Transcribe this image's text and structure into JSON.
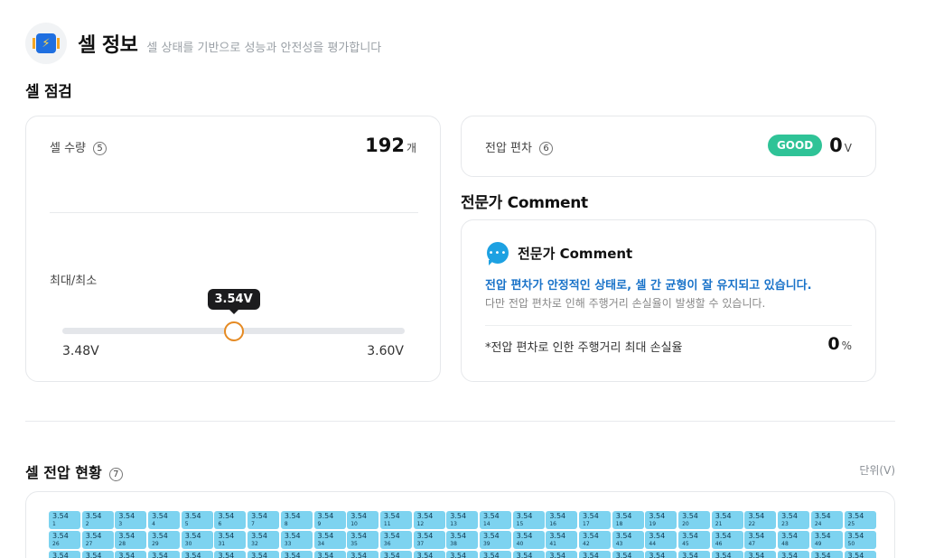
{
  "header": {
    "title": "셀 정보",
    "subtitle": "셀 상태를 기반으로 성능과 안전성을 평가합니다",
    "icon": "battery-chip-icon"
  },
  "inspection": {
    "section_title": "셀 점검",
    "cell_count": {
      "label": "셀 수량",
      "badge": "5",
      "value": "192",
      "unit": "개"
    },
    "minmax": {
      "label": "최대/최소",
      "current": "3.54V",
      "min": "3.48V",
      "max": "3.60V",
      "level_fraction": 0.5
    },
    "deviation": {
      "label": "전압 편차",
      "badge": "6",
      "status": "GOOD",
      "value": "0",
      "unit": "V",
      "status_color": "#2fc397"
    }
  },
  "expert": {
    "section_title": "전문가 Comment",
    "card_title": "전문가 Comment",
    "headline": "전압 편차가 안정적인 상태로, 셀 간 균형이 잘 유지되고 있습니다.",
    "detail": "다만 전압 편차로 인해 주행거리 손실율이 발생할 수 있습니다.",
    "loss_label": "*전압 편차로 인한 주행거리 최대 손실율",
    "loss_value": "0",
    "loss_unit": "%",
    "headline_color": "#1a73c9"
  },
  "voltage_status": {
    "section_title": "셀 전압 현황",
    "badge": "7",
    "unit_label": "단위(V)",
    "cells": [
      {
        "v": "3.54",
        "i": "1"
      },
      {
        "v": "3.54",
        "i": "2"
      },
      {
        "v": "3.54",
        "i": "3"
      },
      {
        "v": "3.54",
        "i": "4"
      },
      {
        "v": "3.54",
        "i": "5"
      },
      {
        "v": "3.54",
        "i": "6"
      },
      {
        "v": "3.54",
        "i": "7"
      },
      {
        "v": "3.54",
        "i": "8"
      },
      {
        "v": "3.54",
        "i": "9"
      },
      {
        "v": "3.54",
        "i": "10"
      },
      {
        "v": "3.54",
        "i": "11"
      },
      {
        "v": "3.54",
        "i": "12"
      },
      {
        "v": "3.54",
        "i": "13"
      },
      {
        "v": "3.54",
        "i": "14"
      },
      {
        "v": "3.54",
        "i": "15"
      },
      {
        "v": "3.54",
        "i": "16"
      },
      {
        "v": "3.54",
        "i": "17"
      },
      {
        "v": "3.54",
        "i": "18"
      },
      {
        "v": "3.54",
        "i": "19"
      },
      {
        "v": "3.54",
        "i": "20"
      },
      {
        "v": "3.54",
        "i": "21"
      },
      {
        "v": "3.54",
        "i": "22"
      },
      {
        "v": "3.54",
        "i": "23"
      },
      {
        "v": "3.54",
        "i": "24"
      },
      {
        "v": "3.54",
        "i": "25"
      },
      {
        "v": "3.54",
        "i": "26"
      },
      {
        "v": "3.54",
        "i": "27"
      },
      {
        "v": "3.54",
        "i": "28"
      },
      {
        "v": "3.54",
        "i": "29"
      },
      {
        "v": "3.54",
        "i": "30"
      },
      {
        "v": "3.54",
        "i": "31"
      },
      {
        "v": "3.54",
        "i": "32"
      },
      {
        "v": "3.54",
        "i": "33"
      },
      {
        "v": "3.54",
        "i": "34"
      },
      {
        "v": "3.54",
        "i": "35"
      },
      {
        "v": "3.54",
        "i": "36"
      },
      {
        "v": "3.54",
        "i": "37"
      },
      {
        "v": "3.54",
        "i": "38"
      },
      {
        "v": "3.54",
        "i": "39"
      },
      {
        "v": "3.54",
        "i": "40"
      },
      {
        "v": "3.54",
        "i": "41"
      },
      {
        "v": "3.54",
        "i": "42"
      },
      {
        "v": "3.54",
        "i": "43"
      },
      {
        "v": "3.54",
        "i": "44"
      },
      {
        "v": "3.54",
        "i": "45"
      },
      {
        "v": "3.54",
        "i": "46"
      },
      {
        "v": "3.54",
        "i": "47"
      },
      {
        "v": "3.54",
        "i": "48"
      },
      {
        "v": "3.54",
        "i": "49"
      },
      {
        "v": "3.54",
        "i": "50"
      },
      {
        "v": "3.54",
        "i": ""
      },
      {
        "v": "3.54",
        "i": ""
      },
      {
        "v": "3.54",
        "i": ""
      },
      {
        "v": "3.54",
        "i": ""
      },
      {
        "v": "3.54",
        "i": ""
      },
      {
        "v": "3.54",
        "i": ""
      },
      {
        "v": "3.54",
        "i": ""
      },
      {
        "v": "3.54",
        "i": ""
      },
      {
        "v": "3.54",
        "i": ""
      },
      {
        "v": "3.54",
        "i": ""
      },
      {
        "v": "3.54",
        "i": ""
      },
      {
        "v": "3.54",
        "i": ""
      },
      {
        "v": "3.54",
        "i": ""
      },
      {
        "v": "3.54",
        "i": ""
      },
      {
        "v": "3.54",
        "i": ""
      },
      {
        "v": "3.54",
        "i": ""
      },
      {
        "v": "3.54",
        "i": ""
      },
      {
        "v": "3.54",
        "i": ""
      },
      {
        "v": "3.54",
        "i": ""
      },
      {
        "v": "3.54",
        "i": ""
      },
      {
        "v": "3.54",
        "i": ""
      },
      {
        "v": "3.54",
        "i": ""
      },
      {
        "v": "3.54",
        "i": ""
      },
      {
        "v": "3.54",
        "i": ""
      },
      {
        "v": "3.54",
        "i": ""
      }
    ],
    "cell_color": "#7dd3f0"
  }
}
